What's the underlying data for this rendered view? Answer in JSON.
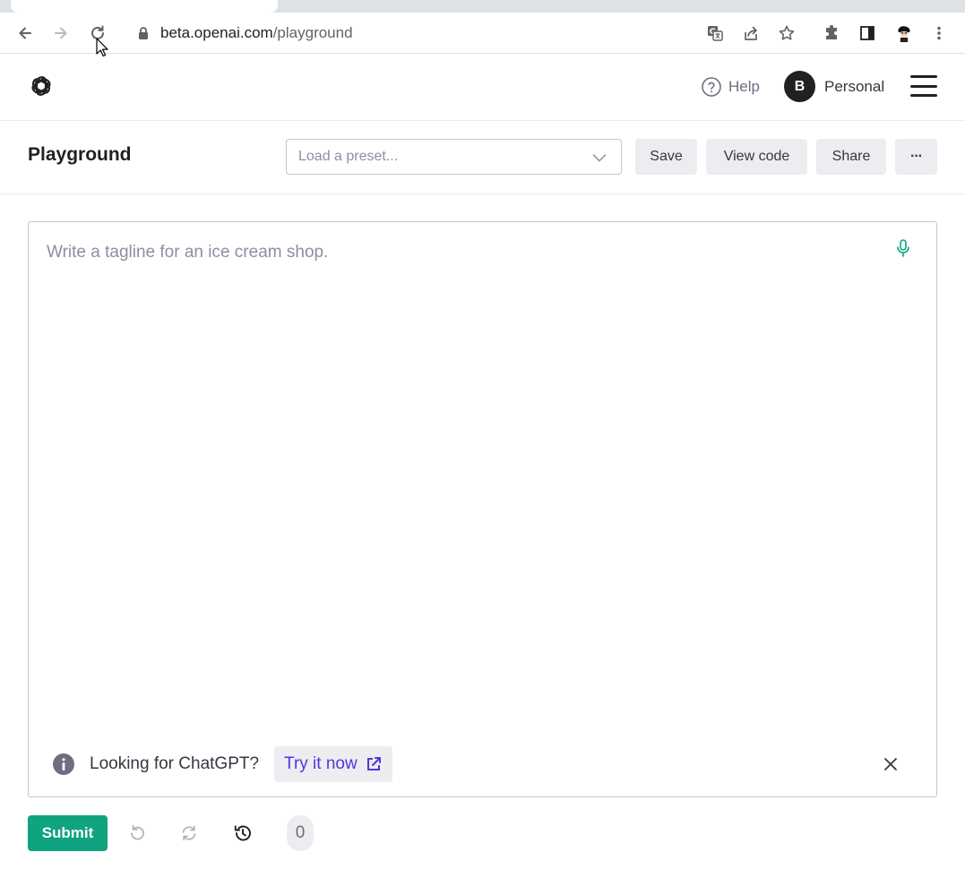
{
  "browser": {
    "url_host": "beta.openai.com",
    "url_path": "/playground"
  },
  "header": {
    "help_label": "Help",
    "avatar_initial": "B",
    "account_label": "Personal"
  },
  "playground": {
    "title": "Playground",
    "preset_placeholder": "Load a preset...",
    "save_label": "Save",
    "view_code_label": "View code",
    "share_label": "Share",
    "more_label": "···"
  },
  "editor": {
    "placeholder": "Write a tagline for an ice cream shop.",
    "banner_text": "Looking for ChatGPT?",
    "banner_link": "Try it now"
  },
  "footer": {
    "submit_label": "Submit",
    "token_count": "0"
  },
  "colors": {
    "accent": "#10a37f",
    "link": "#5436da",
    "button_bg": "#ececf1"
  },
  "icons": [
    "back-arrow-icon",
    "forward-arrow-icon",
    "reload-icon",
    "lock-icon",
    "translate-icon",
    "share-page-icon",
    "star-icon",
    "extensions-icon",
    "side-panel-icon",
    "profile-icon",
    "kebab-menu-icon",
    "openai-logo-icon",
    "help-icon",
    "hamburger-icon",
    "chevron-down-icon",
    "microphone-icon",
    "info-icon",
    "external-link-icon",
    "close-icon",
    "undo-icon",
    "regenerate-icon",
    "history-icon"
  ]
}
